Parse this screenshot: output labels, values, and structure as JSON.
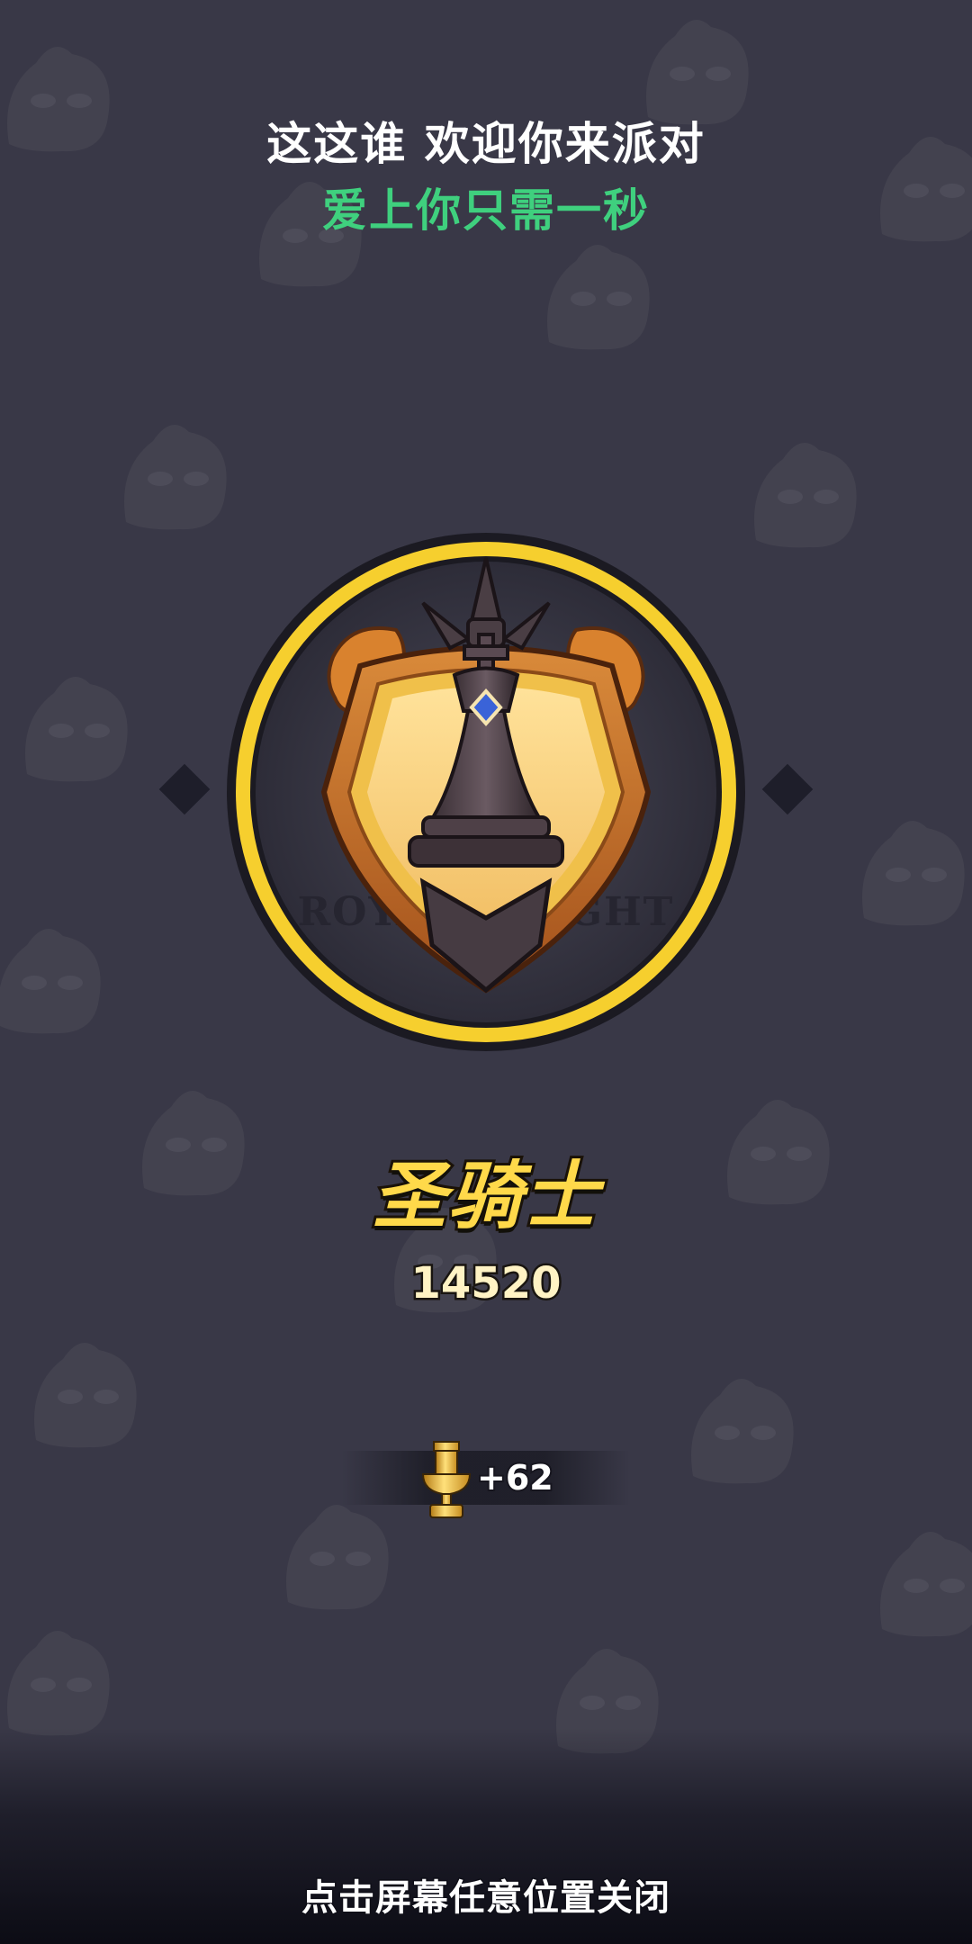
{
  "header": {
    "title": "这这谁 欢迎你来派对",
    "subtitle": "爱上你只需一秒"
  },
  "badge": {
    "icon": "knight-rank-badge-icon",
    "watermark_text": "ROYAL KNIGHT"
  },
  "rank": {
    "name": "圣骑士",
    "score": "14520"
  },
  "reward": {
    "icon": "trophy-icon",
    "gain": "+62"
  },
  "footer": {
    "close_hint": "点击屏幕任意位置关闭"
  },
  "colors": {
    "background": "#393847",
    "subtitle_green": "#3fd07e",
    "rank_gold": "#ffd94a",
    "ring_yellow": "#f6cf2e"
  }
}
